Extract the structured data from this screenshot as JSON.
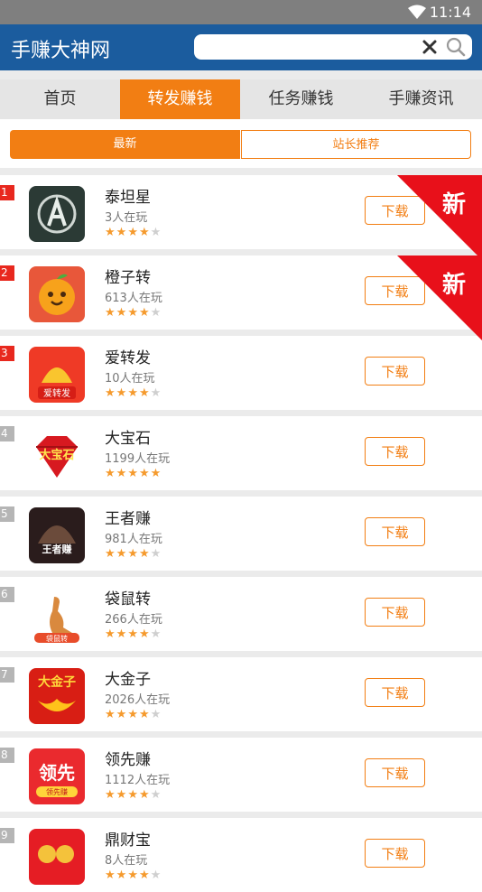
{
  "status_bar": {
    "time": "11:14"
  },
  "header": {
    "title": "手赚大神网",
    "search_placeholder": ""
  },
  "tabs": [
    {
      "label": "首页",
      "active": false
    },
    {
      "label": "转发赚钱",
      "active": true
    },
    {
      "label": "任务赚钱",
      "active": false
    },
    {
      "label": "手赚资讯",
      "active": false
    }
  ],
  "segments": [
    {
      "label": "最新",
      "active": true
    },
    {
      "label": "站长推荐",
      "active": false
    }
  ],
  "colors": {
    "accent": "#f27e13",
    "header": "#1b5c9e",
    "rank_top": "#e8281e",
    "rank_other": "#b5b5b5",
    "ribbon": "#e8101a"
  },
  "apps": [
    {
      "rank": "1",
      "name": "泰坦星",
      "players": "3人在玩",
      "rating": 4,
      "button": "下载",
      "badge": "新",
      "icon": "titan-star-icon"
    },
    {
      "rank": "2",
      "name": "橙子转",
      "players": "613人在玩",
      "rating": 4,
      "button": "下载",
      "badge": "新",
      "icon": "orange-icon"
    },
    {
      "rank": "3",
      "name": "爱转发",
      "players": "10人在玩",
      "rating": 4,
      "button": "下载",
      "badge": "",
      "icon": "love-forward-icon",
      "icon_text": "爱转发"
    },
    {
      "rank": "4",
      "name": "大宝石",
      "players": "1199人在玩",
      "rating": 5,
      "button": "下载",
      "badge": "",
      "icon": "gem-icon",
      "icon_text": "大宝石"
    },
    {
      "rank": "5",
      "name": "王者赚",
      "players": "981人在玩",
      "rating": 4,
      "button": "下载",
      "badge": "",
      "icon": "king-icon",
      "icon_text": "王者赚"
    },
    {
      "rank": "6",
      "name": "袋鼠转",
      "players": "266人在玩",
      "rating": 4,
      "button": "下载",
      "badge": "",
      "icon": "kangaroo-icon",
      "icon_text": "袋鼠转"
    },
    {
      "rank": "7",
      "name": "大金子",
      "players": "2026人在玩",
      "rating": 4,
      "button": "下载",
      "badge": "",
      "icon": "gold-ingot-icon",
      "icon_text": "大金子"
    },
    {
      "rank": "8",
      "name": "领先赚",
      "players": "1112人在玩",
      "rating": 4,
      "button": "下载",
      "badge": "",
      "icon": "lead-icon",
      "icon_text": "领先",
      "icon_subtext": "领先赚"
    },
    {
      "rank": "9",
      "name": "鼎财宝",
      "players": "8人在玩",
      "rating": 4,
      "button": "下载",
      "badge": "",
      "icon": "ding-cai-icon"
    }
  ]
}
